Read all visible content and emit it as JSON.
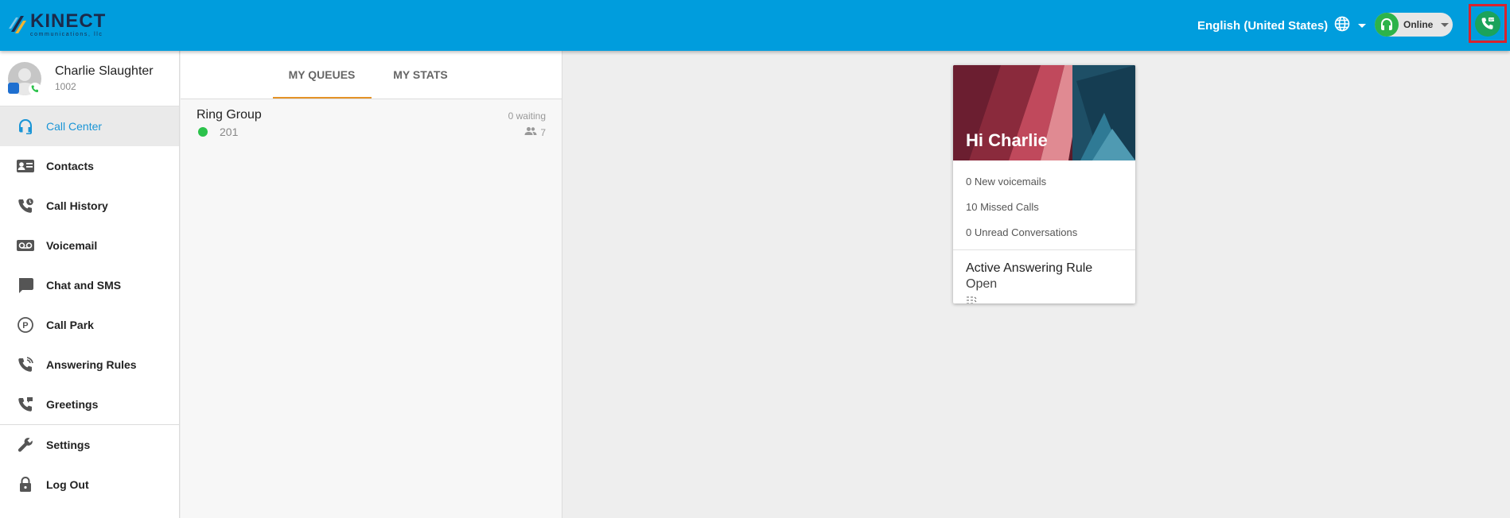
{
  "header": {
    "logo_text": "KINECT",
    "logo_subtext": "communications, llc",
    "language": "English (United States)",
    "status_label": "Online"
  },
  "user": {
    "name": "Charlie Slaughter",
    "extension": "1002"
  },
  "sidebar": {
    "items": [
      {
        "label": "Call Center",
        "icon": "headset-icon",
        "active": true
      },
      {
        "label": "Contacts",
        "icon": "contacts-icon"
      },
      {
        "label": "Call History",
        "icon": "call-history-icon"
      },
      {
        "label": "Voicemail",
        "icon": "voicemail-icon"
      },
      {
        "label": "Chat and SMS",
        "icon": "chat-icon"
      },
      {
        "label": "Call Park",
        "icon": "park-icon"
      },
      {
        "label": "Answering Rules",
        "icon": "answering-rules-icon"
      },
      {
        "label": "Greetings",
        "icon": "greetings-icon"
      },
      {
        "label": "Settings",
        "icon": "wrench-icon"
      },
      {
        "label": "Log Out",
        "icon": "lock-icon"
      }
    ]
  },
  "queues": {
    "tabs": [
      {
        "label": "MY QUEUES",
        "active": true
      },
      {
        "label": "MY STATS"
      }
    ],
    "rows": [
      {
        "name": "Ring Group",
        "number": "201",
        "waiting": "0 waiting",
        "agents": "7",
        "status_color": "#2bc24b"
      }
    ]
  },
  "card": {
    "greeting": "Hi Charlie",
    "stats": [
      "0 New voicemails",
      "10 Missed Calls",
      "0 Unread Conversations"
    ],
    "rule_title": "Active Answering Rule",
    "rule_value": "Open"
  },
  "colors": {
    "header": "#009ddd",
    "accent": "#e59327",
    "active_nav": "#1a95d6",
    "online": "#2db34a"
  }
}
